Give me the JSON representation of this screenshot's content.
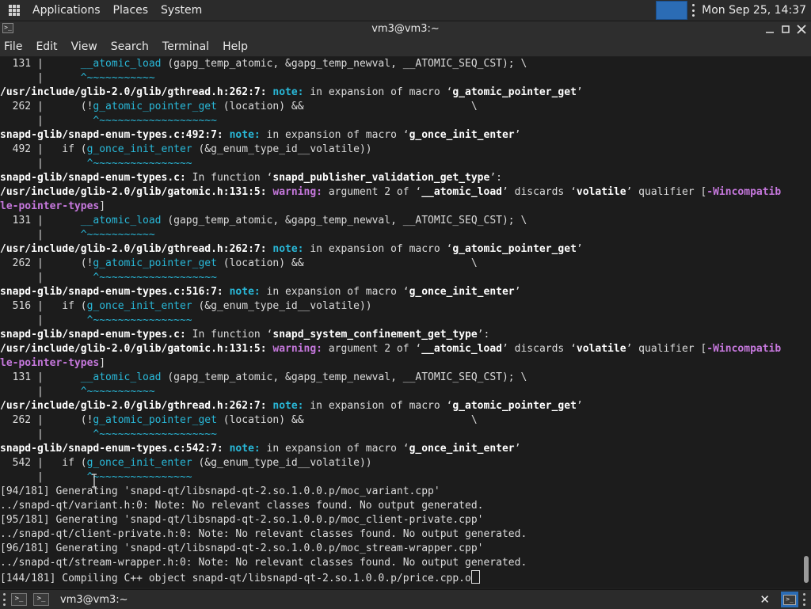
{
  "top_panel": {
    "menus": [
      "Applications",
      "Places",
      "System"
    ],
    "clock": "Mon Sep 25, 14:37"
  },
  "window": {
    "title": "vm3@vm3:~",
    "menubar": [
      "File",
      "Edit",
      "View",
      "Search",
      "Terminal",
      "Help"
    ]
  },
  "terminal": {
    "lines": [
      [
        {
          "t": "  131 |      ",
          "c": ""
        },
        {
          "t": "__atomic_load",
          "c": "hl"
        },
        {
          "t": " (gapg_temp_atomic, &gapg_temp_newval, __ATOMIC_SEQ_CST); \\",
          "c": ""
        }
      ],
      [
        {
          "t": "      |      ",
          "c": ""
        },
        {
          "t": "^~~~~~~~~~~~",
          "c": "car"
        }
      ],
      [
        {
          "t": "/usr/include/glib-2.0/glib/gthread.h:262:7: ",
          "c": "b"
        },
        {
          "t": "note:",
          "c": "note"
        },
        {
          "t": " in expansion of macro ‘",
          "c": ""
        },
        {
          "t": "g_atomic_pointer_get",
          "c": "b"
        },
        {
          "t": "’",
          "c": ""
        }
      ],
      [
        {
          "t": "  262 |      (!",
          "c": ""
        },
        {
          "t": "g_atomic_pointer_get",
          "c": "hl"
        },
        {
          "t": " (location) &&                           \\",
          "c": ""
        }
      ],
      [
        {
          "t": "      |        ",
          "c": ""
        },
        {
          "t": "^~~~~~~~~~~~~~~~~~~~",
          "c": "car"
        }
      ],
      [
        {
          "t": "snapd-glib/snapd-enum-types.c:492:7: ",
          "c": "b"
        },
        {
          "t": "note:",
          "c": "note"
        },
        {
          "t": " in expansion of macro ‘",
          "c": ""
        },
        {
          "t": "g_once_init_enter",
          "c": "b"
        },
        {
          "t": "’",
          "c": ""
        }
      ],
      [
        {
          "t": "  492 |   if (",
          "c": ""
        },
        {
          "t": "g_once_init_enter",
          "c": "hl"
        },
        {
          "t": " (&g_enum_type_id__volatile))",
          "c": ""
        }
      ],
      [
        {
          "t": "      |       ",
          "c": ""
        },
        {
          "t": "^~~~~~~~~~~~~~~~~",
          "c": "car"
        }
      ],
      [
        {
          "t": "snapd-glib/snapd-enum-types.c:",
          "c": "b"
        },
        {
          "t": " In function ‘",
          "c": ""
        },
        {
          "t": "snapd_publisher_validation_get_type",
          "c": "b"
        },
        {
          "t": "’:",
          "c": ""
        }
      ],
      [
        {
          "t": "/usr/include/glib-2.0/glib/gatomic.h:131:5: ",
          "c": "b"
        },
        {
          "t": "warning:",
          "c": "warn"
        },
        {
          "t": " argument 2 of ‘",
          "c": ""
        },
        {
          "t": "__atomic_load",
          "c": "b"
        },
        {
          "t": "’ discards ‘",
          "c": ""
        },
        {
          "t": "volatile",
          "c": "b"
        },
        {
          "t": "’ qualifier [",
          "c": ""
        },
        {
          "t": "-Wincompatib",
          "c": "flag"
        }
      ],
      [
        {
          "t": "le-pointer-types",
          "c": "flag"
        },
        {
          "t": "]",
          "c": ""
        }
      ],
      [
        {
          "t": "  131 |      ",
          "c": ""
        },
        {
          "t": "__atomic_load",
          "c": "hl"
        },
        {
          "t": " (gapg_temp_atomic, &gapg_temp_newval, __ATOMIC_SEQ_CST); \\",
          "c": ""
        }
      ],
      [
        {
          "t": "      |      ",
          "c": ""
        },
        {
          "t": "^~~~~~~~~~~~",
          "c": "car"
        }
      ],
      [
        {
          "t": "/usr/include/glib-2.0/glib/gthread.h:262:7: ",
          "c": "b"
        },
        {
          "t": "note:",
          "c": "note"
        },
        {
          "t": " in expansion of macro ‘",
          "c": ""
        },
        {
          "t": "g_atomic_pointer_get",
          "c": "b"
        },
        {
          "t": "’",
          "c": ""
        }
      ],
      [
        {
          "t": "  262 |      (!",
          "c": ""
        },
        {
          "t": "g_atomic_pointer_get",
          "c": "hl"
        },
        {
          "t": " (location) &&                           \\",
          "c": ""
        }
      ],
      [
        {
          "t": "      |        ",
          "c": ""
        },
        {
          "t": "^~~~~~~~~~~~~~~~~~~~",
          "c": "car"
        }
      ],
      [
        {
          "t": "snapd-glib/snapd-enum-types.c:516:7: ",
          "c": "b"
        },
        {
          "t": "note:",
          "c": "note"
        },
        {
          "t": " in expansion of macro ‘",
          "c": ""
        },
        {
          "t": "g_once_init_enter",
          "c": "b"
        },
        {
          "t": "’",
          "c": ""
        }
      ],
      [
        {
          "t": "  516 |   if (",
          "c": ""
        },
        {
          "t": "g_once_init_enter",
          "c": "hl"
        },
        {
          "t": " (&g_enum_type_id__volatile))",
          "c": ""
        }
      ],
      [
        {
          "t": "      |       ",
          "c": ""
        },
        {
          "t": "^~~~~~~~~~~~~~~~~",
          "c": "car"
        }
      ],
      [
        {
          "t": "snapd-glib/snapd-enum-types.c:",
          "c": "b"
        },
        {
          "t": " In function ‘",
          "c": ""
        },
        {
          "t": "snapd_system_confinement_get_type",
          "c": "b"
        },
        {
          "t": "’:",
          "c": ""
        }
      ],
      [
        {
          "t": "/usr/include/glib-2.0/glib/gatomic.h:131:5: ",
          "c": "b"
        },
        {
          "t": "warning:",
          "c": "warn"
        },
        {
          "t": " argument 2 of ‘",
          "c": ""
        },
        {
          "t": "__atomic_load",
          "c": "b"
        },
        {
          "t": "’ discards ‘",
          "c": ""
        },
        {
          "t": "volatile",
          "c": "b"
        },
        {
          "t": "’ qualifier [",
          "c": ""
        },
        {
          "t": "-Wincompatib",
          "c": "flag"
        }
      ],
      [
        {
          "t": "le-pointer-types",
          "c": "flag"
        },
        {
          "t": "]",
          "c": ""
        }
      ],
      [
        {
          "t": "  131 |      ",
          "c": ""
        },
        {
          "t": "__atomic_load",
          "c": "hl"
        },
        {
          "t": " (gapg_temp_atomic, &gapg_temp_newval, __ATOMIC_SEQ_CST); \\",
          "c": ""
        }
      ],
      [
        {
          "t": "      |      ",
          "c": ""
        },
        {
          "t": "^~~~~~~~~~~~",
          "c": "car"
        }
      ],
      [
        {
          "t": "/usr/include/glib-2.0/glib/gthread.h:262:7: ",
          "c": "b"
        },
        {
          "t": "note:",
          "c": "note"
        },
        {
          "t": " in expansion of macro ‘",
          "c": ""
        },
        {
          "t": "g_atomic_pointer_get",
          "c": "b"
        },
        {
          "t": "’",
          "c": ""
        }
      ],
      [
        {
          "t": "  262 |      (!",
          "c": ""
        },
        {
          "t": "g_atomic_pointer_get",
          "c": "hl"
        },
        {
          "t": " (location) &&                           \\",
          "c": ""
        }
      ],
      [
        {
          "t": "      |        ",
          "c": ""
        },
        {
          "t": "^~~~~~~~~~~~~~~~~~~~",
          "c": "car"
        }
      ],
      [
        {
          "t": "snapd-glib/snapd-enum-types.c:542:7: ",
          "c": "b"
        },
        {
          "t": "note:",
          "c": "note"
        },
        {
          "t": " in expansion of macro ‘",
          "c": ""
        },
        {
          "t": "g_once_init_enter",
          "c": "b"
        },
        {
          "t": "’",
          "c": ""
        }
      ],
      [
        {
          "t": "  542 |   if (",
          "c": ""
        },
        {
          "t": "g_once_init_enter",
          "c": "hl"
        },
        {
          "t": " (&g_enum_type_id__volatile))",
          "c": ""
        }
      ],
      [
        {
          "t": "      |       ",
          "c": ""
        },
        {
          "t": "^~~~~~~~~~~~~~~~~",
          "c": "car"
        }
      ],
      [
        {
          "t": "[94/181] Generating 'snapd-qt/libsnapd-qt-2.so.1.0.0.p/moc_variant.cpp'",
          "c": ""
        }
      ],
      [
        {
          "t": "../snapd-qt/variant.h:0: Note: No relevant classes found. No output generated.",
          "c": ""
        }
      ],
      [
        {
          "t": "[95/181] Generating 'snapd-qt/libsnapd-qt-2.so.1.0.0.p/moc_client-private.cpp'",
          "c": ""
        }
      ],
      [
        {
          "t": "../snapd-qt/client-private.h:0: Note: No relevant classes found. No output generated.",
          "c": ""
        }
      ],
      [
        {
          "t": "[96/181] Generating 'snapd-qt/libsnapd-qt-2.so.1.0.0.p/moc_stream-wrapper.cpp'",
          "c": ""
        }
      ],
      [
        {
          "t": "../snapd-qt/stream-wrapper.h:0: Note: No relevant classes found. No output generated.",
          "c": ""
        }
      ],
      [
        {
          "t": "[144/181] Compiling C++ object snapd-qt/libsnapd-qt-2.so.1.0.0.p/price.cpp.o",
          "c": ""
        }
      ]
    ]
  },
  "taskbar": {
    "task_label": "vm3@vm3:~",
    "close_glyph": "✕"
  },
  "colors": {
    "accent": "#2b6cb5",
    "note": "#29b8d8",
    "warning": "#c678dd"
  }
}
